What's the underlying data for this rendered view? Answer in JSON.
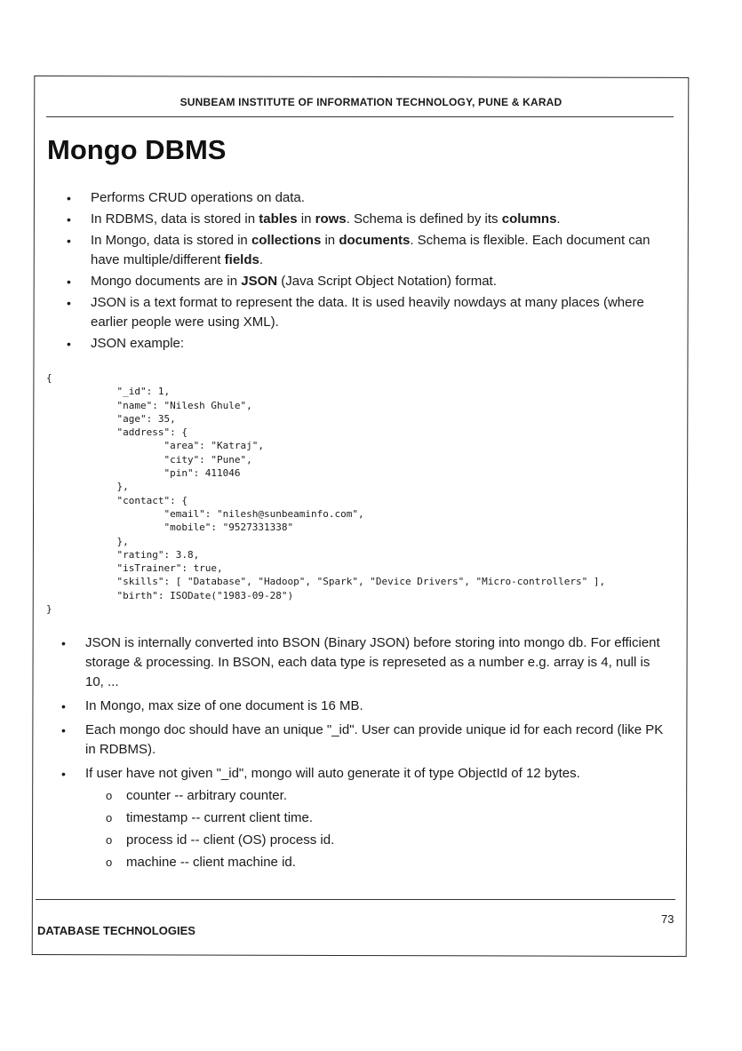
{
  "header": {
    "institute": "SUNBEAM INSTITUTE OF INFORMATION TECHNOLOGY, PUNE & KARAD"
  },
  "title": "Mongo DBMS",
  "bullets_top": [
    {
      "segments": [
        {
          "t": "Performs CRUD operations on data.",
          "b": false
        }
      ]
    },
    {
      "segments": [
        {
          "t": "In RDBMS, data is stored in ",
          "b": false
        },
        {
          "t": "tables",
          "b": true
        },
        {
          "t": " in ",
          "b": false
        },
        {
          "t": "rows",
          "b": true
        },
        {
          "t": ". Schema is defined by its ",
          "b": false
        },
        {
          "t": "columns",
          "b": true
        },
        {
          "t": ".",
          "b": false
        }
      ]
    },
    {
      "segments": [
        {
          "t": "In Mongo, data is stored in ",
          "b": false
        },
        {
          "t": "collections",
          "b": true
        },
        {
          "t": " in ",
          "b": false
        },
        {
          "t": "documents",
          "b": true
        },
        {
          "t": ". Schema is flexible. Each document can have multiple/different ",
          "b": false
        },
        {
          "t": "fields",
          "b": true
        },
        {
          "t": ".",
          "b": false
        }
      ]
    },
    {
      "segments": [
        {
          "t": "Mongo documents are in ",
          "b": false
        },
        {
          "t": "JSON",
          "b": true
        },
        {
          "t": " (Java Script Object Notation) format.",
          "b": false
        }
      ]
    },
    {
      "segments": [
        {
          "t": "JSON is a text format to represent the data. It is used heavily nowdays at many places (where earlier people were using XML).",
          "b": false
        }
      ]
    },
    {
      "segments": [
        {
          "t": "JSON example:",
          "b": false
        }
      ]
    }
  ],
  "json_example": "{\n            \"_id\": 1,\n            \"name\": \"Nilesh Ghule\",\n            \"age\": 35,\n            \"address\": {\n                    \"area\": \"Katraj\",\n                    \"city\": \"Pune\",\n                    \"pin\": 411046\n            },\n            \"contact\": {\n                    \"email\": \"nilesh@sunbeaminfo.com\",\n                    \"mobile\": \"9527331338\"\n            },\n            \"rating\": 3.8,\n            \"isTrainer\": true,\n            \"skills\": [ \"Database\", \"Hadoop\", \"Spark\", \"Device Drivers\", \"Micro-controllers\" ],\n            \"birth\": ISODate(\"1983-09-28\")\n}",
  "bullets_bottom": [
    {
      "text": "JSON is internally converted into BSON (Binary JSON) before storing into mongo db. For efficient storage & processing. In BSON, each data type is represeted as a number e.g. array is 4, null is 10, ..."
    },
    {
      "text": "In Mongo, max size of one document is 16 MB."
    },
    {
      "text": "Each mongo doc should have an unique \"_id\". User can provide unique id for each record (like PK in RDBMS)."
    },
    {
      "text": "If user have not given \"_id\", mongo will auto generate it of type ObjectId of 12 bytes."
    }
  ],
  "objectid_parts": [
    "counter -- arbitrary counter.",
    "timestamp -- current client time.",
    "process id -- client (OS) process id.",
    "machine -- client machine id."
  ],
  "footer": {
    "page_number": "73",
    "course": "DATABASE TECHNOLOGIES"
  }
}
